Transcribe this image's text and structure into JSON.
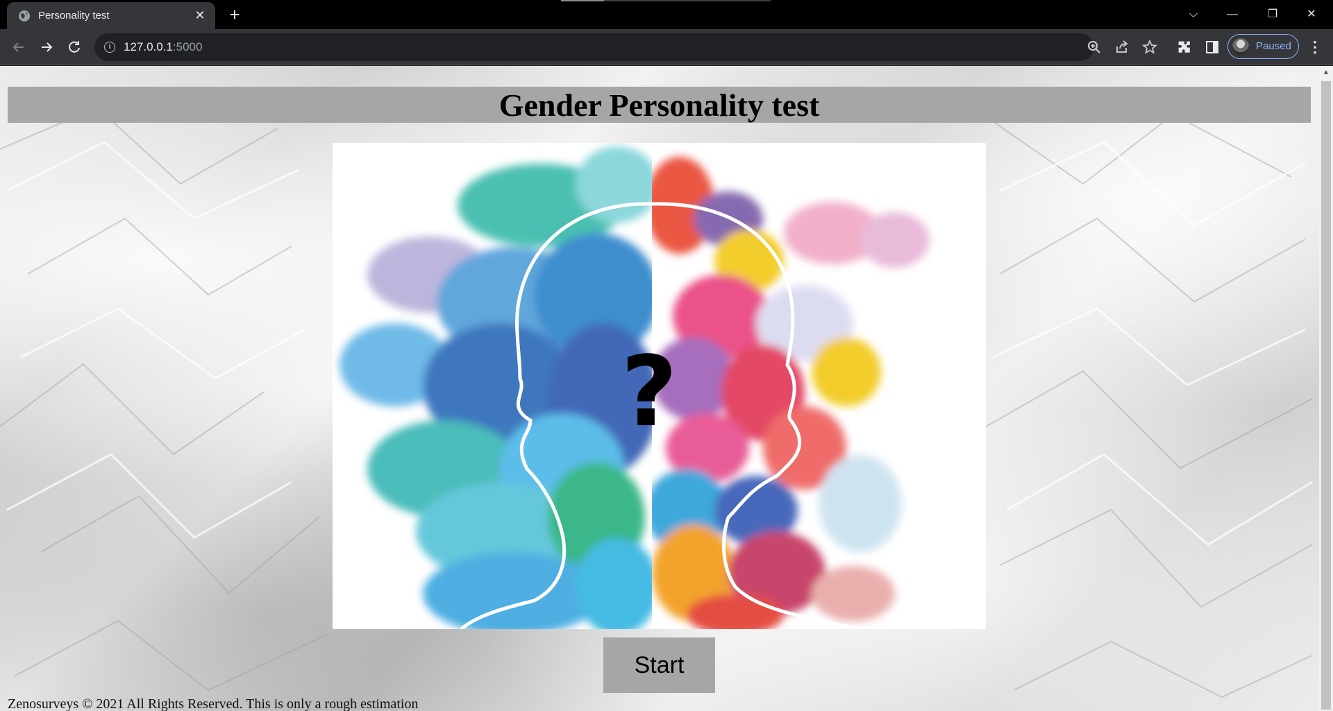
{
  "browser": {
    "tab": {
      "title": "Personality test",
      "close_glyph": "✕"
    },
    "new_tab_glyph": "+",
    "address": {
      "host": "127.0.0.1",
      "port": ":5000"
    },
    "profile": {
      "label": "Paused"
    },
    "window_controls": {
      "tabsearch": "⌵",
      "minimize": "—",
      "restore": "❐",
      "close": "✕"
    },
    "icons": [
      "globe-icon",
      "back-icon",
      "forward-icon",
      "reload-icon",
      "info-icon",
      "zoom-icon",
      "share-icon",
      "star-icon",
      "extensions-icon",
      "side-panel-icon",
      "menu-icon"
    ]
  },
  "page": {
    "title": "Gender Personality test",
    "hero_image": {
      "description_icon": "split-head-watercolor-illustration",
      "glyph": "?"
    },
    "start_label": "Start",
    "footer": "Zenosurveys © 2021 All Rights Reserved. This is only a rough estimation"
  },
  "colors": {
    "header_bar": "#a6a6a6",
    "start_button": "#a6a6a6",
    "profile_accent": "#8ab4f8"
  }
}
